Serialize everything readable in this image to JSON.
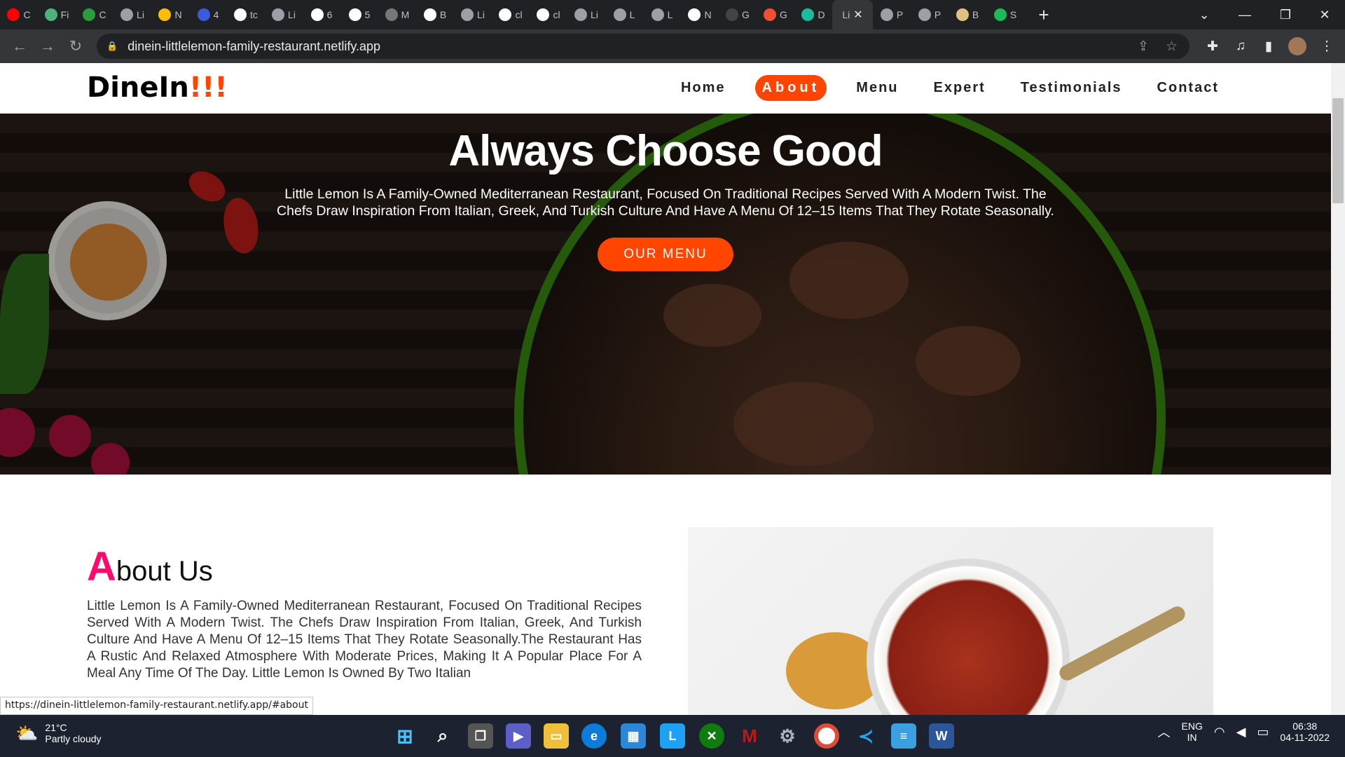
{
  "browser": {
    "tabs": [
      {
        "icon": "youtube-icon",
        "label": "C",
        "color": "#ff0000"
      },
      {
        "icon": "framer-icon",
        "label": "Fi",
        "color": "#4fb27a"
      },
      {
        "icon": "webflow-icon",
        "label": "C",
        "color": "#2a9d3a"
      },
      {
        "icon": "globe-icon",
        "label": "Li",
        "color": "#9aa0a6"
      },
      {
        "icon": "drive-icon",
        "label": "N",
        "color": "#fbbc04"
      },
      {
        "icon": "star-app-icon",
        "label": "4",
        "color": "#3b5bdb"
      },
      {
        "icon": "google-icon",
        "label": "tc",
        "color": "#ffffff"
      },
      {
        "icon": "globe-icon",
        "label": "Li",
        "color": "#9aa0a6"
      },
      {
        "icon": "f-icon",
        "label": "6",
        "color": "#ffffff"
      },
      {
        "icon": "github-icon",
        "label": "5",
        "color": "#ffffff"
      },
      {
        "icon": "app-icon",
        "label": "M",
        "color": "#777777"
      },
      {
        "icon": "x-icon",
        "label": "B",
        "color": "#ffffff"
      },
      {
        "icon": "globe-icon",
        "label": "Li",
        "color": "#9aa0a6"
      },
      {
        "icon": "google-icon",
        "label": "cl",
        "color": "#ffffff"
      },
      {
        "icon": "google-icon",
        "label": "cl",
        "color": "#ffffff"
      },
      {
        "icon": "globe-icon",
        "label": "Li",
        "color": "#9aa0a6"
      },
      {
        "icon": "globe-icon",
        "label": "L",
        "color": "#9aa0a6"
      },
      {
        "icon": "globe-icon",
        "label": "L",
        "color": "#9aa0a6"
      },
      {
        "icon": "chrome-icon",
        "label": "N",
        "color": "#ffffff"
      },
      {
        "icon": "github-icon",
        "label": "G",
        "color": "#444444"
      },
      {
        "icon": "git-icon",
        "label": "G",
        "color": "#f05032"
      },
      {
        "icon": "diamond-icon",
        "label": "D",
        "color": "#1abc9c"
      },
      {
        "icon": "none",
        "label": "Li",
        "color": "#9aa0a6",
        "active": true
      },
      {
        "icon": "globe-icon",
        "label": "P",
        "color": "#9aa0a6"
      },
      {
        "icon": "globe-icon",
        "label": "P",
        "color": "#9aa0a6"
      },
      {
        "icon": "image-icon",
        "label": "B",
        "color": "#e0c080"
      },
      {
        "icon": "spotify-icon",
        "label": "S",
        "color": "#1db954"
      }
    ],
    "url": "dinein-littlelemon-family-restaurant.netlify.app",
    "status_url": "https://dinein-littlelemon-family-restaurant.netlify.app/#about"
  },
  "site": {
    "logo_text": "DineIn",
    "logo_excl": "!!!",
    "nav": [
      "Home",
      "About",
      "Menu",
      "Expert",
      "Testimonials",
      "Contact"
    ],
    "active_nav": "About",
    "accent": "#ff4500",
    "hero": {
      "title": "Always Choose Good",
      "text": "Little Lemon Is A Family-Owned Mediterranean Restaurant, Focused On Traditional Recipes Served With A Modern Twist. The Chefs Draw Inspiration From Italian, Greek, And Turkish Culture And Have A Menu Of 12–15 Items That They Rotate Seasonally.",
      "button": "OUR MENU"
    },
    "about": {
      "title_first": "A",
      "title_rest": "bout Us",
      "text": "Little Lemon Is A Family-Owned Mediterranean Restaurant, Focused On Traditional Recipes Served With A Modern Twist. The Chefs Draw Inspiration From Italian, Greek, And Turkish Culture And Have A Menu Of 12–15 Items That They Rotate Seasonally.The Restaurant Has A Rustic And Relaxed Atmosphere With Moderate Prices, Making It A Popular Place For A Meal Any Time Of The Day. Little Lemon Is Owned By Two Italian"
    }
  },
  "taskbar": {
    "weather_temp": "21°C",
    "weather_desc": "Partly cloudy",
    "lang_top": "ENG",
    "lang_bottom": "IN",
    "time": "06:38",
    "date": "04-11-2022"
  }
}
